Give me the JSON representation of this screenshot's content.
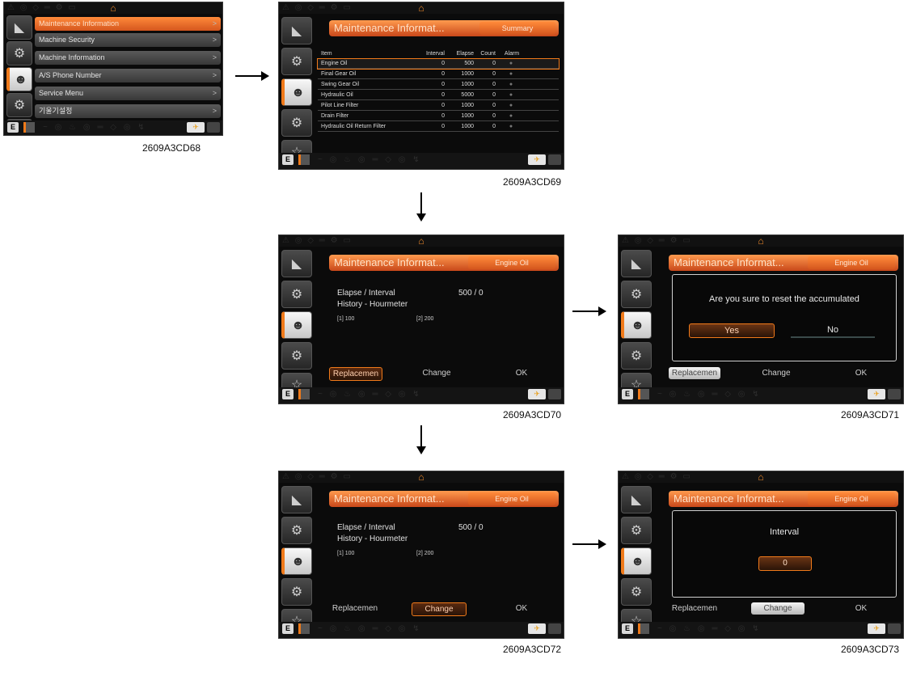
{
  "figure_ids": [
    "2609A3CD68",
    "2609A3CD69",
    "2609A3CD70",
    "2609A3CD71",
    "2609A3CD72",
    "2609A3CD73"
  ],
  "common": {
    "title": "Maintenance Informat...",
    "engine_oil_tag": "Engine Oil",
    "summary_tag": "Summary",
    "e_label": "E"
  },
  "menu": {
    "items": [
      "Maintenance Information",
      "Machine Security",
      "Machine Information",
      "A/S Phone Number",
      "Service Menu",
      "기울기설정"
    ],
    "chevron": ">"
  },
  "summary_table": {
    "headers": [
      "Item",
      "Interval",
      "Elapse",
      "Count",
      "Alarm"
    ],
    "rows": [
      [
        "Engine Oil",
        "0",
        "500",
        "0"
      ],
      [
        "Final Gear Oil",
        "0",
        "1000",
        "0"
      ],
      [
        "Swing  Gear Oil",
        "0",
        "1000",
        "0"
      ],
      [
        "Hydraulic Oil",
        "0",
        "5000",
        "0"
      ],
      [
        "Pilot Line Filter",
        "0",
        "1000",
        "0"
      ],
      [
        "Drain Filter",
        "0",
        "1000",
        "0"
      ],
      [
        "Hydraulic Oil Return Filter",
        "0",
        "1000",
        "0"
      ]
    ]
  },
  "detail": {
    "elapse_label": "Elapse / Interval",
    "elapse_value": "500 / 0",
    "history_label": "History - Hourmeter",
    "hist_1": "[1] 100",
    "hist_2": "[2] 200",
    "btn_replace": "Replacemen",
    "btn_change": "Change",
    "btn_ok": "OK"
  },
  "reset_dialog": {
    "message": "Are you sure to reset the accumulated",
    "yes": "Yes",
    "no": "No"
  },
  "interval_dialog": {
    "label": "Interval",
    "value": "0"
  }
}
